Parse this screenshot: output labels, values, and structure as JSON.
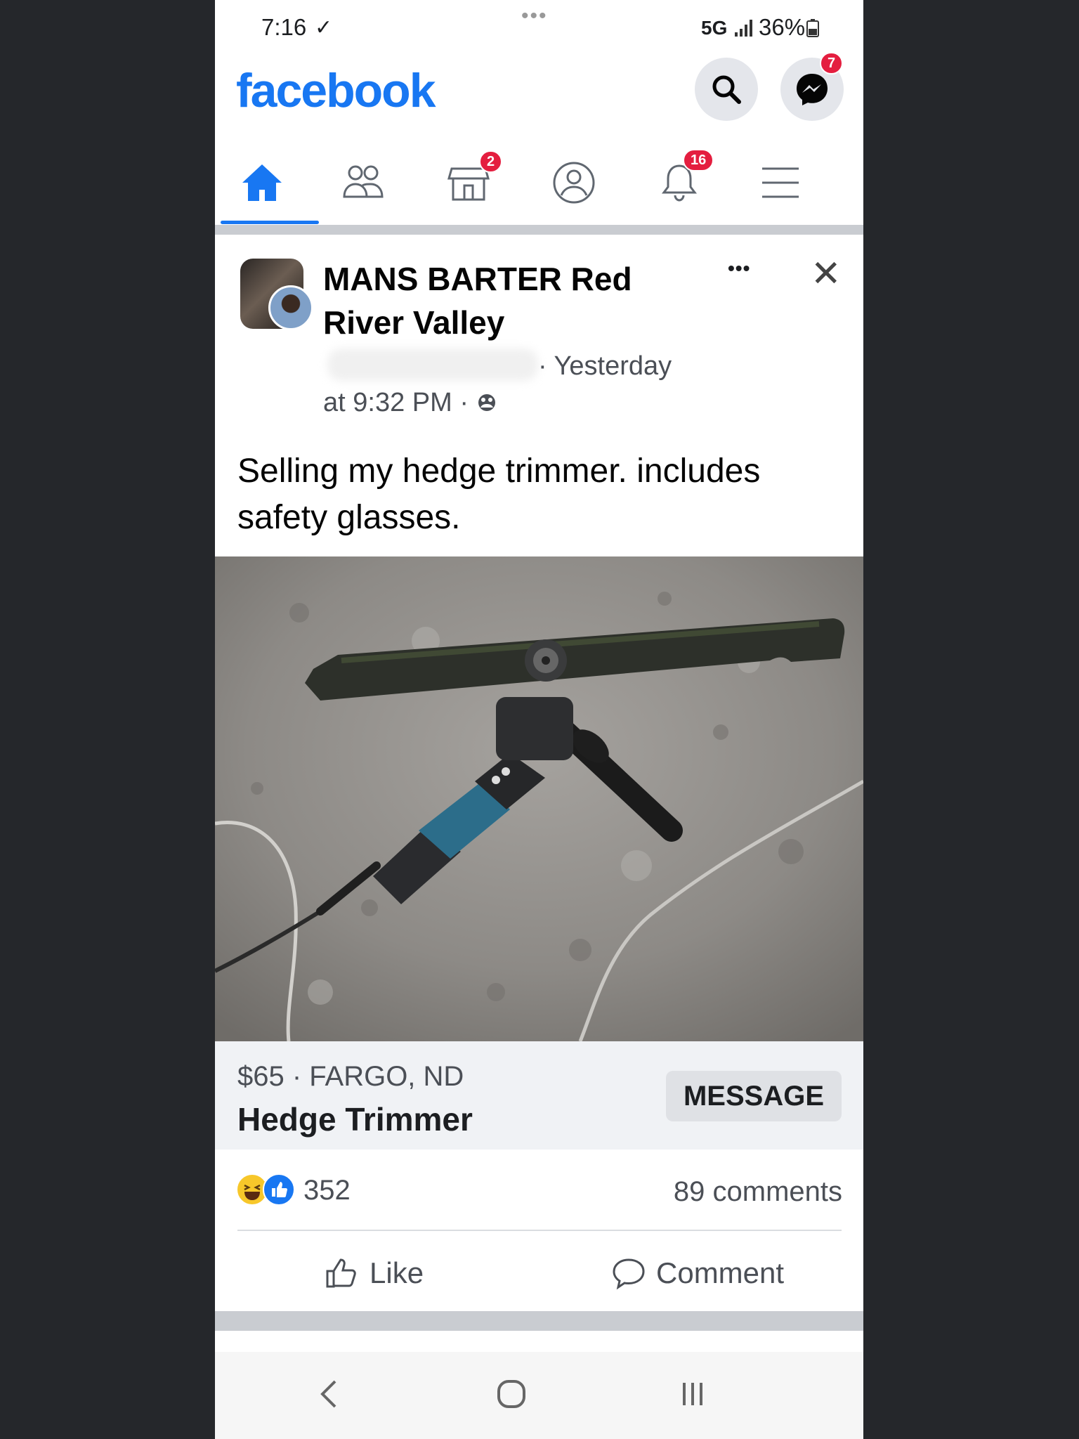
{
  "status_bar": {
    "time": "7:16",
    "network": "5G",
    "battery": "36%"
  },
  "header": {
    "logo": "facebook",
    "messenger_badge": "7",
    "icons": [
      "search-icon",
      "messenger-icon"
    ]
  },
  "nav": {
    "marketplace_badge": "2",
    "notifications_badge": "16",
    "active_tab": "home",
    "icons": [
      "home-icon",
      "friends-icon",
      "marketplace-icon",
      "profile-icon",
      "bell-icon",
      "menu-icon"
    ]
  },
  "post": {
    "group_name": "MANS BARTER Red River Valley",
    "time_part1": "· Yesterday",
    "time_part2": "at 9:32 PM ·",
    "text": "Selling my hedge trimmer. includes safety glasses.",
    "listing": {
      "price_location": "$65 · FARGO, ND",
      "title": "Hedge Trimmer",
      "message_label": "MESSAGE"
    },
    "reactions_count": "352",
    "comments_count": "89 comments",
    "like_label": "Like",
    "comment_label": "Comment"
  },
  "colors": {
    "brand": "#1877f2",
    "badge": "#e41e3f"
  }
}
